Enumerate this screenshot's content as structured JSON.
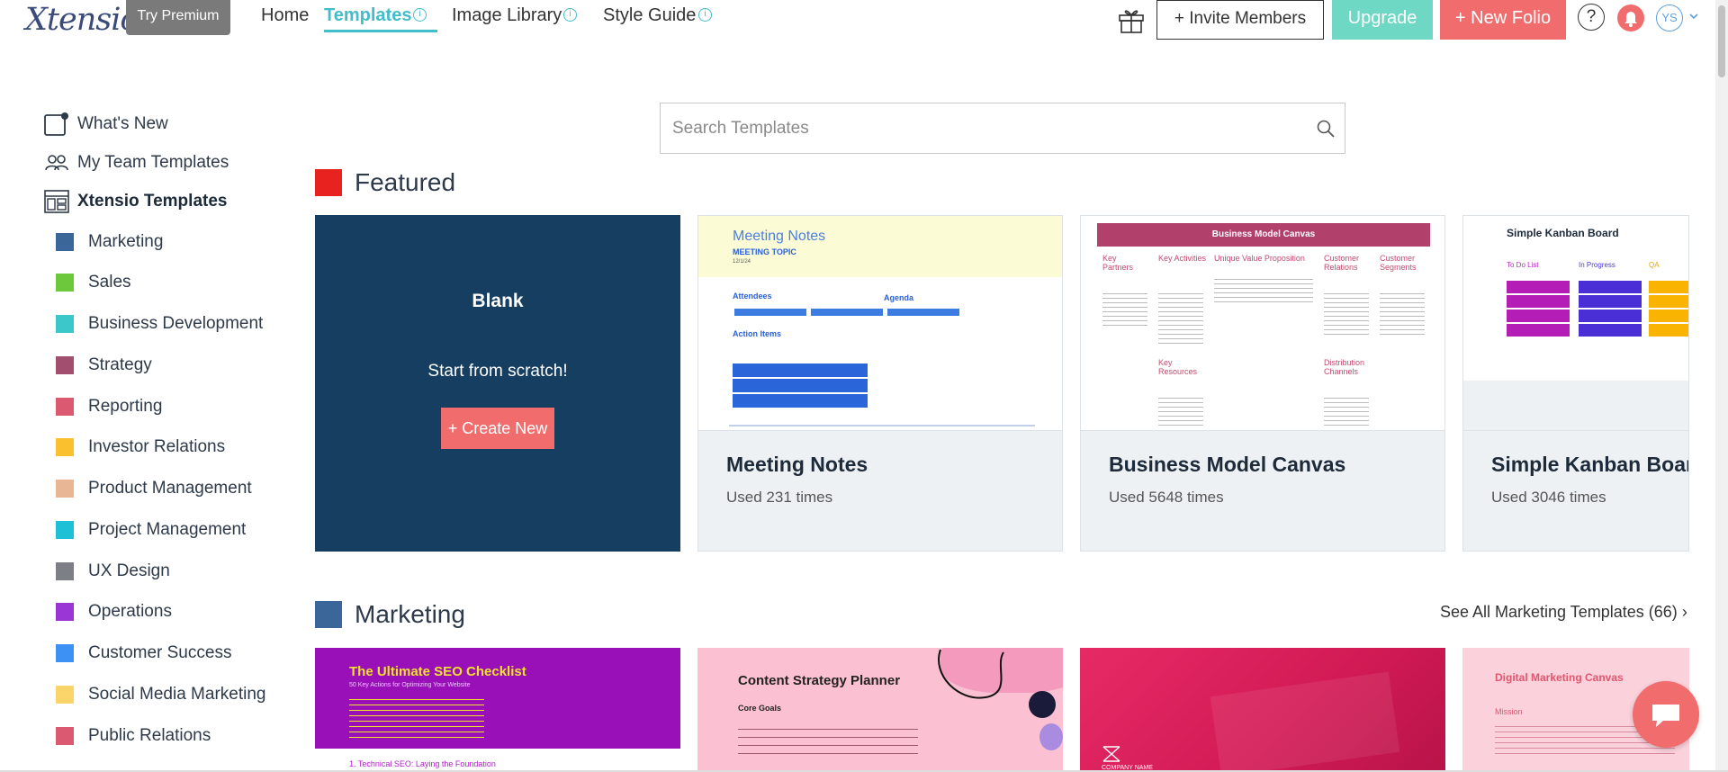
{
  "brand": {
    "logo": "Xtensio",
    "try_premium": "Try Premium"
  },
  "nav": {
    "home": "Home",
    "templates": "Templates",
    "image_library": "Image Library",
    "style_guide": "Style Guide",
    "info_glyph": "i"
  },
  "header_actions": {
    "invite": "+ Invite Members",
    "upgrade": "Upgrade",
    "new_folio": "+ New Folio",
    "help": "?",
    "avatar_initials": "YS"
  },
  "sidebar": {
    "top_items": [
      {
        "label": "What's New",
        "icon": "whats-new-icon"
      },
      {
        "label": "My Team Templates",
        "icon": "team-icon"
      },
      {
        "label": "Xtensio Templates",
        "icon": "templates-icon"
      }
    ],
    "categories": [
      {
        "label": "Marketing",
        "color": "#3a6699"
      },
      {
        "label": "Sales",
        "color": "#6dc83c"
      },
      {
        "label": "Business Development",
        "color": "#3cc8c8"
      },
      {
        "label": "Strategy",
        "color": "#a14f6e"
      },
      {
        "label": "Reporting",
        "color": "#dc5a71"
      },
      {
        "label": "Investor Relations",
        "color": "#fbc02d"
      },
      {
        "label": "Product Management",
        "color": "#e8b694"
      },
      {
        "label": "Project Management",
        "color": "#1ec0d6"
      },
      {
        "label": "UX Design",
        "color": "#7c7f86"
      },
      {
        "label": "Operations",
        "color": "#9b36d6"
      },
      {
        "label": "Customer Success",
        "color": "#3d91f5"
      },
      {
        "label": "Social Media Marketing",
        "color": "#fcd56a"
      },
      {
        "label": "Public Relations",
        "color": "#dc5a71"
      }
    ]
  },
  "search": {
    "placeholder": "Search Templates"
  },
  "featured": {
    "title": "Featured",
    "color": "#e8231f",
    "blank": {
      "title": "Blank",
      "subtitle": "Start from scratch!",
      "button": "+ Create New"
    },
    "cards": [
      {
        "name": "Meeting Notes",
        "used": "Used 231 times"
      },
      {
        "name": "Business Model Canvas",
        "used": "Used 5648 times"
      },
      {
        "name": "Simple Kanban Board",
        "used": "Used 3046 times"
      }
    ]
  },
  "marketing": {
    "title": "Marketing",
    "color": "#3a6699",
    "see_all": "See All Marketing Templates (66)",
    "cards": [
      {
        "title": "The Ultimate SEO Checklist",
        "subtitle": "50 Key Actions for Optimizing Your Website",
        "section": "1. Technical SEO: Laying the Foundation"
      },
      {
        "title": "Content Strategy Planner",
        "subtitle": "Core Goals"
      },
      {
        "title": "",
        "subtitle": "COMPANY NAME"
      },
      {
        "title": "Digital Marketing Canvas",
        "subtitle": "Mission"
      }
    ]
  },
  "thumbs": {
    "meeting": {
      "heading": "Meeting Notes",
      "topic": "MEETING TOPIC",
      "date": "12/1/24",
      "attendees": "Attendees",
      "agenda": "Agenda",
      "action_items": "Action Items"
    },
    "bmc": {
      "heading": "Business Model Canvas",
      "cols": [
        "Key Partners",
        "Key Activities",
        "Unique Value Proposition",
        "Customer Relations",
        "Customer Segments"
      ],
      "row2": [
        "Key Resources",
        "Distribution Channels"
      ]
    },
    "kanban": {
      "heading": "Simple Kanban Board",
      "cols": [
        "To Do List",
        "In Progress",
        "QA"
      ]
    }
  }
}
